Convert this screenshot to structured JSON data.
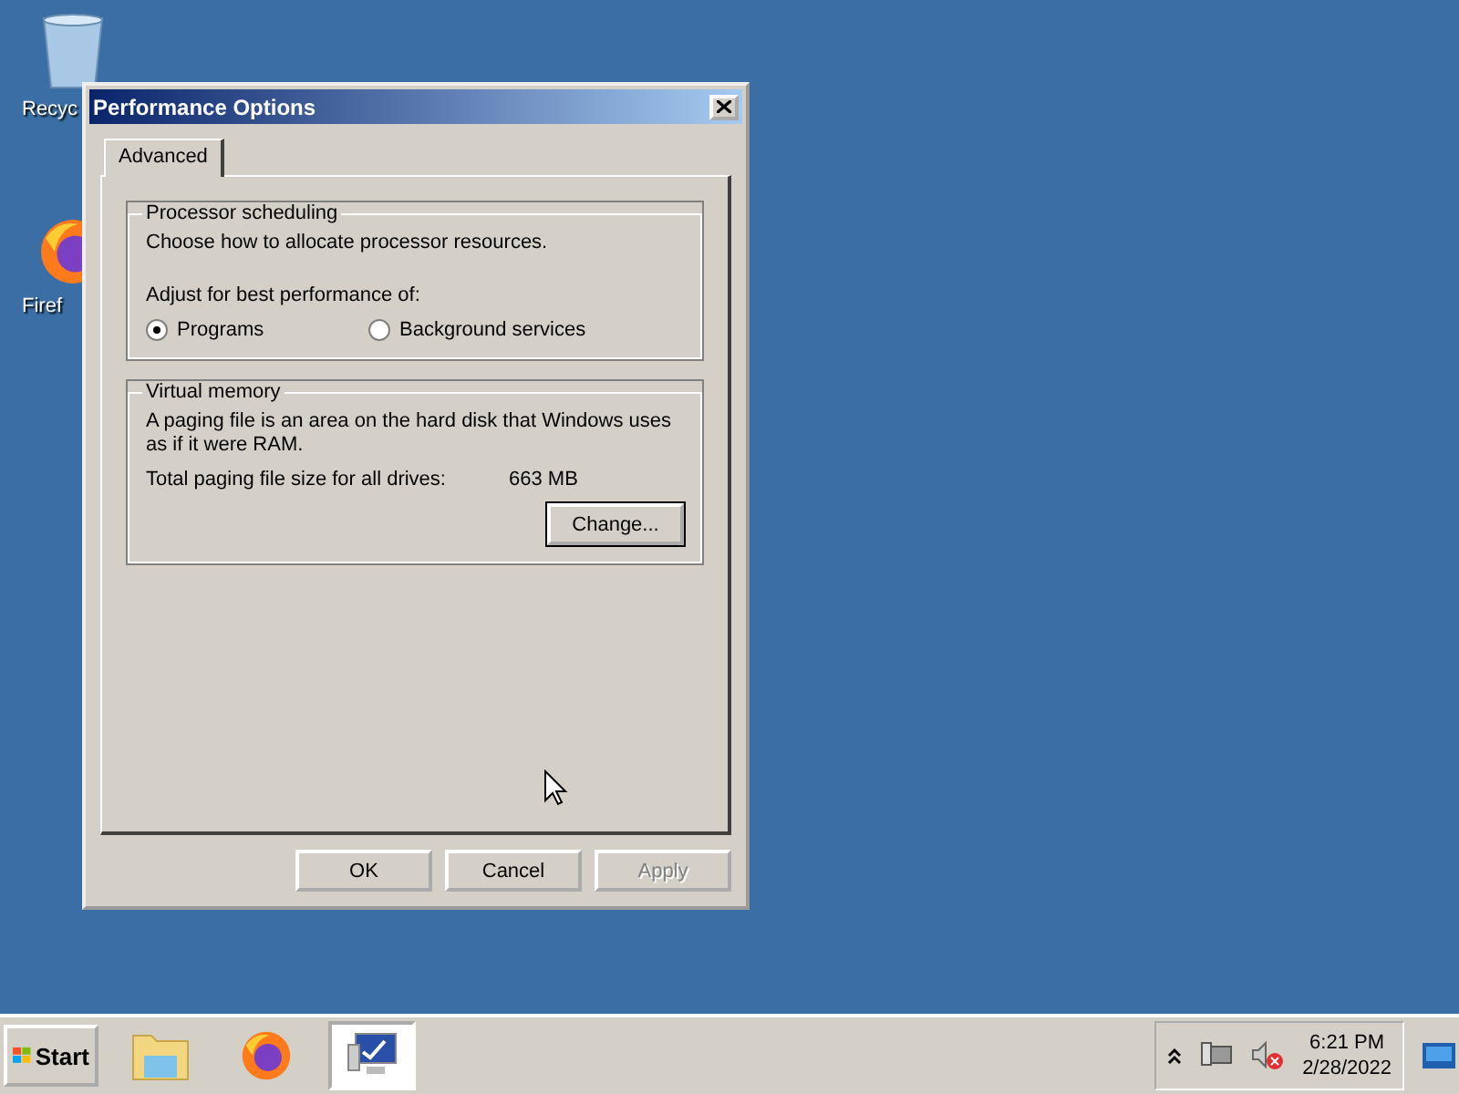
{
  "desktop_icons": [
    {
      "label": "Recyc",
      "kind": "bin"
    },
    {
      "label": "Firef",
      "kind": "browser"
    }
  ],
  "window": {
    "title": "Performance Options",
    "tabs": [
      {
        "label": "Advanced",
        "selected": true
      }
    ],
    "processor_scheduling": {
      "title": "Processor scheduling",
      "description": "Choose how to allocate processor resources.",
      "prompt": "Adjust for best performance of:",
      "options": [
        {
          "label": "Programs",
          "selected": true
        },
        {
          "label": "Background services",
          "selected": false
        }
      ]
    },
    "virtual_memory": {
      "title": "Virtual memory",
      "description": "A paging file is an area on the hard disk that Windows uses as if it were RAM.",
      "size_label": "Total paging file size for all drives:",
      "size_value": "663 MB",
      "button": "Change..."
    },
    "buttons": [
      {
        "label": "OK",
        "disabled": false
      },
      {
        "label": "Cancel",
        "disabled": false
      },
      {
        "label": "Apply",
        "disabled": true
      }
    ]
  },
  "taskbar": {
    "start": "Start",
    "items": [
      {
        "kind": "folder",
        "selected": false
      },
      {
        "kind": "browser",
        "selected": false
      },
      {
        "kind": "monitor",
        "selected": true
      }
    ],
    "clock_time": "6:21 PM",
    "clock_date": "2/28/2022"
  }
}
